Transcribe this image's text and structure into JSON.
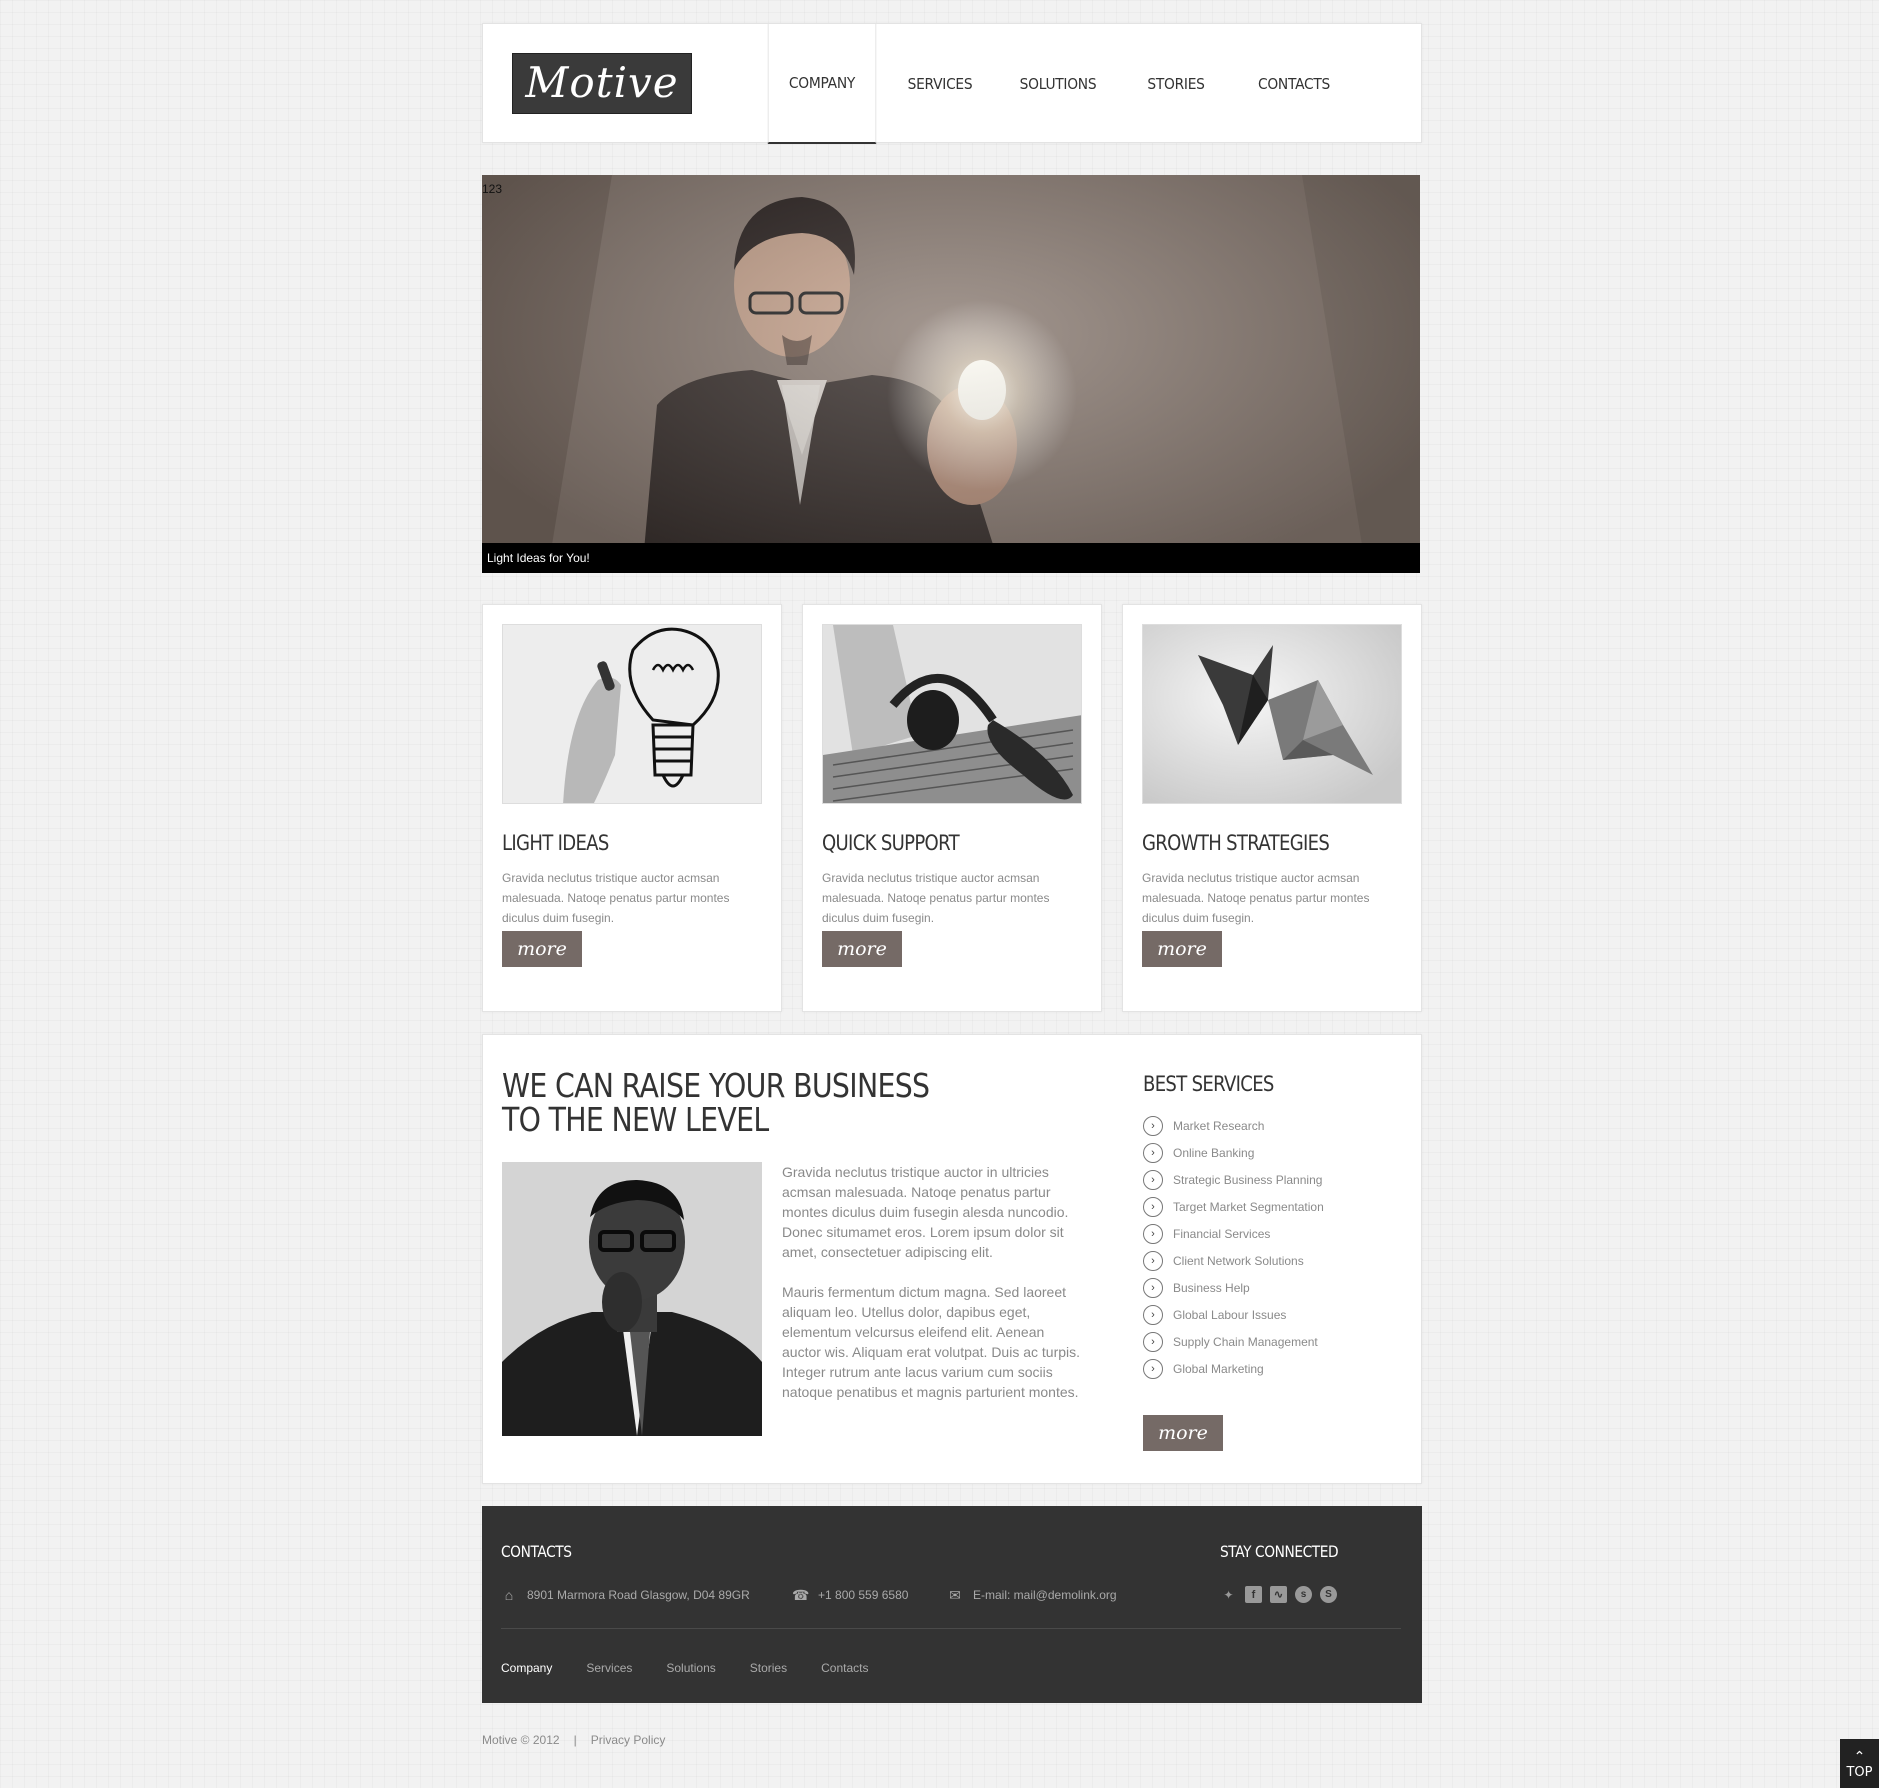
{
  "header": {
    "logo": "Motive",
    "nav": [
      "COMPANY",
      "SERVICES",
      "SOLUTIONS",
      "STORIES",
      "CONTACTS"
    ]
  },
  "slider": {
    "counter": "123",
    "caption": "Light Ideas for You!"
  },
  "features": [
    {
      "title": "LIGHT IDEAS",
      "text": "Gravida neclutus tristique auctor acmsan malesuada. Natoqe penatus partur montes diculus duim fusegin.",
      "button": "more"
    },
    {
      "title": "QUICK SUPPORT",
      "text": "Gravida neclutus tristique auctor acmsan malesuada. Natoqe penatus partur montes diculus duim fusegin.",
      "button": "more"
    },
    {
      "title": "GROWTH STRATEGIES",
      "text": "Gravida neclutus tristique auctor acmsan malesuada. Natoqe penatus partur montes diculus duim fusegin.",
      "button": "more"
    }
  ],
  "main": {
    "heading_line1": "WE CAN RAISE YOUR BUSINESS",
    "heading_line2": "TO THE NEW LEVEL",
    "paragraph1": "Gravida neclutus tristique auctor in ultricies acmsan malesuada. Natoqe penatus partur montes diculus duim fusegin alesda nuncodio. Donec situmamet eros. Lorem ipsum dolor sit amet, consectetuer adipiscing elit.",
    "paragraph2": "Mauris fermentum dictum magna. Sed laoreet aliquam leo. Utellus dolor, dapibus eget, elementum velcursus eleifend elit. Aenean auctor wis. Aliquam erat volutpat. Duis ac turpis. Integer rutrum ante lacus varium cum sociis natoque penatibus et magnis parturient montes."
  },
  "best_services": {
    "title": "BEST SERVICES",
    "items": [
      "Market Research",
      "Online Banking",
      "Strategic Business Planning",
      "Target Market Segmentation",
      "Financial Services",
      "Client Network Solutions",
      "Business Help",
      "Global Labour Issues",
      "Supply Chain Management",
      "Global Marketing"
    ],
    "button": "more"
  },
  "footer": {
    "contacts_title": "CONTACTS",
    "address": "8901 Marmora Road Glasgow, D04 89GR",
    "phone": "+1 800 559 6580",
    "email": "E-mail: mail@demolink.org",
    "stay_connected": "STAY CONNECTED",
    "nav": [
      "Company",
      "Services",
      "Solutions",
      "Stories",
      "Contacts"
    ]
  },
  "copyright": {
    "text": "Motive © 2012",
    "separator": "|",
    "privacy": "Privacy Policy"
  },
  "top_button": "TOP"
}
